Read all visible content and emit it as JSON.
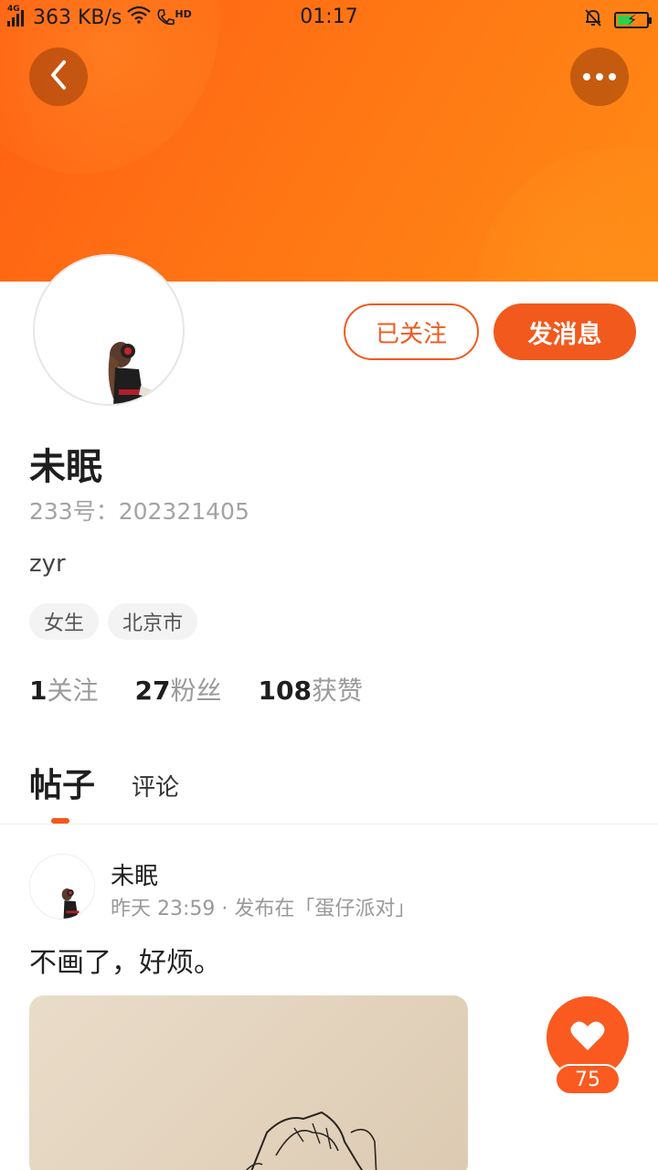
{
  "status_bar": {
    "network": "4G",
    "speed": "363 KB/s",
    "call_badge": "HD",
    "time": "01:17"
  },
  "profile": {
    "name": "未眠",
    "uid": "233号：202321405",
    "bio": "zyr",
    "tags": [
      "女生",
      "北京市"
    ],
    "follow_button": "已关注",
    "message_button": "发消息",
    "stats": {
      "following_count": "1",
      "following_label": "关注",
      "fans_count": "27",
      "fans_label": "粉丝",
      "likes_count": "108",
      "likes_label": "获赞"
    }
  },
  "tabs": [
    "帖子",
    "评论"
  ],
  "post": {
    "author": "未眠",
    "meta": "昨天 23:59 · 发布在「蛋仔派对」",
    "text": "不画了，好烦。",
    "like_count": "75"
  },
  "colors": {
    "accent": "#f2591d",
    "banner": "#ff7414"
  },
  "icons": {
    "back": "chevron-left-icon",
    "more": "more-dots-icon",
    "like": "heart-icon"
  }
}
